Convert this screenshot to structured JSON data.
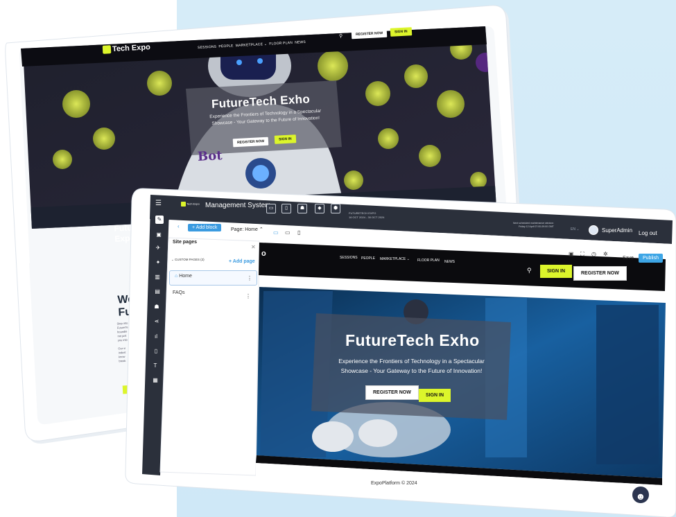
{
  "back_site": {
    "logo": "Tech Expo",
    "nav": [
      "SESSIONS",
      "PEOPLE",
      "MARKETPLACE ⌄",
      "FLOOR PLAN",
      "NEWS"
    ],
    "register_label": "REGISTER NOW",
    "signin_label": "SIGN IN",
    "hero_title": "FutureTech Exho",
    "hero_sub": "Experience the Frontiers of Technology in a Spectacular Showcase - Your Gateway to the Future of Innovation!",
    "hero_register": "REGISTER NOW",
    "hero_signin": "SIGN IN",
    "robot_text": "Bot",
    "side_heading": "Futur\nExpo",
    "section_heading": "We\nFut",
    "body_frag": "Step into\nFutureTe\nboundle\nnot just\nyou into\n\nOur vi\nindust\nknow\nbreak"
  },
  "admin": {
    "logo": "Tech Expo",
    "title": "Management System",
    "expo_name": "FUTURETECH EXPO",
    "expo_dates": "16 OCT 2024 - 30 OCT 2024",
    "maintenance_line1": "Next scheduled maintenance window:",
    "maintenance_line2": "Friday 12 April 07:00-09:00 GMT",
    "language": "EN ⌄",
    "user_name": "SuperAdmin",
    "logout_label": "Log out",
    "add_block_label": "+ Add block",
    "page_label": "Page: Home ⌃",
    "save_label": "Save",
    "publish_label": "Publish"
  },
  "site_pages": {
    "title": "Site pages",
    "section_label": "CUSTOM PAGES (2)",
    "add_page_label": "+ Add page",
    "pages": [
      {
        "label": "Home"
      },
      {
        "label": "FAQs"
      }
    ]
  },
  "preview": {
    "logo_fragment": "o",
    "nav": [
      "SESSIONS",
      "PEOPLE",
      "MARKETPLACE ⌄",
      "FLOOR PLAN",
      "NEWS"
    ],
    "signin_label": "SIGN IN",
    "register_label": "REGISTER NOW",
    "hero_title": "FutureTech Exho",
    "hero_sub": "Experience the Frontiers of Technology in a Spectacular Showcase - Your Gateway to the Future of Innovation!",
    "hero_register": "REGISTER NOW",
    "hero_signin": "SIGN IN",
    "footer": "ExpoPlatform © 2024"
  },
  "colors": {
    "accent_blue": "#3b9be0",
    "lime": "#dcf52b",
    "dark_bar": "#2b303b",
    "background_tint": "#d6ecf8"
  },
  "icons": [
    "menu-icon",
    "pencil-icon",
    "layout-icon",
    "plane-icon",
    "star-icon",
    "bar-chart-icon",
    "briefcase-icon",
    "users-icon",
    "share-icon",
    "analytics-icon",
    "mobile-icon",
    "paint-icon",
    "document-icon",
    "monitor-icon",
    "tablet-icon",
    "image-icon",
    "expand-icon",
    "history-icon",
    "gear-icon",
    "search-icon",
    "robot-icon"
  ]
}
